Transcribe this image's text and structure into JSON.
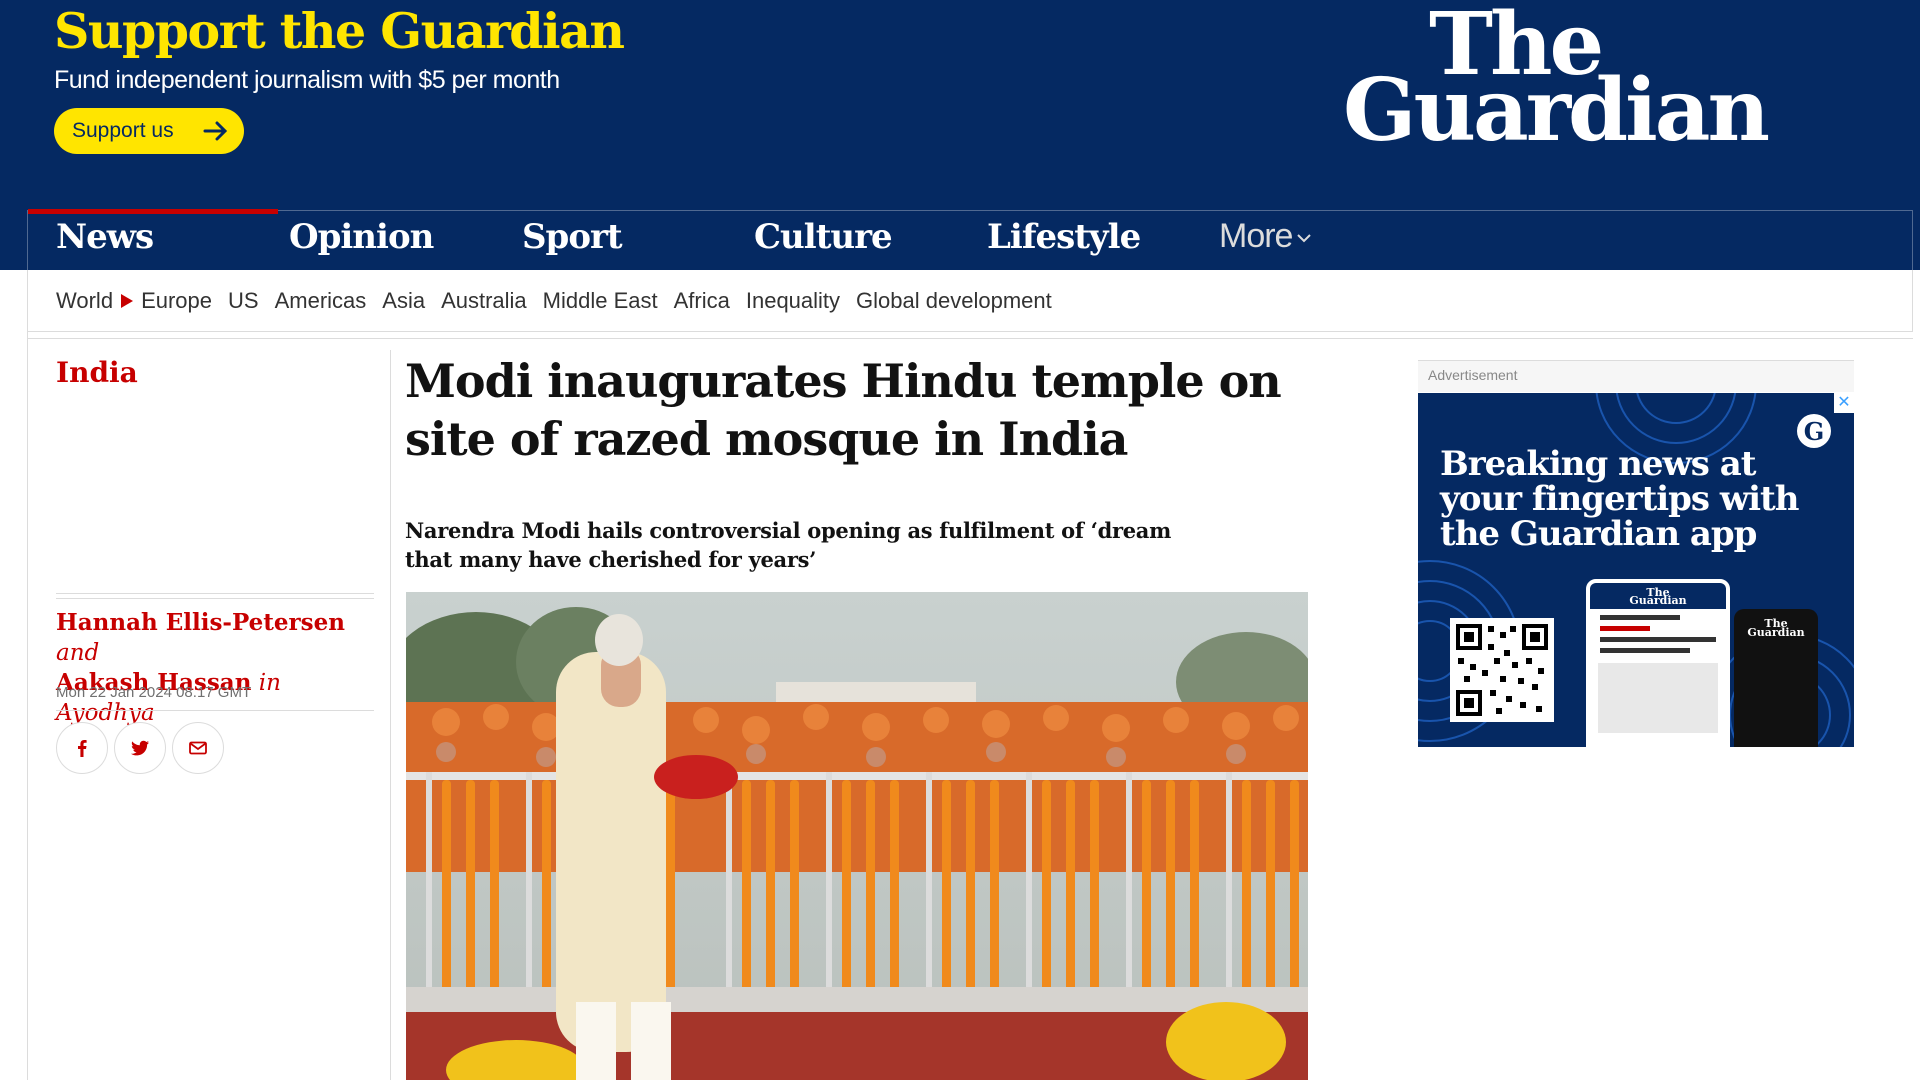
{
  "header": {
    "support_title": "Support the Guardian",
    "support_subtitle": "Fund independent journalism with $5 per month",
    "support_button": "Support us",
    "logo_line1": "The",
    "logo_line2": "Guardian"
  },
  "nav": {
    "items": [
      {
        "label": "News",
        "active": true
      },
      {
        "label": "Opinion"
      },
      {
        "label": "Sport"
      },
      {
        "label": "Culture"
      },
      {
        "label": "Lifestyle"
      }
    ],
    "more_label": "More"
  },
  "subnav": {
    "items": [
      "World",
      "Europe",
      "US",
      "Americas",
      "Asia",
      "Australia",
      "Middle East",
      "Africa",
      "Inequality",
      "Global development"
    ]
  },
  "article": {
    "section": "India",
    "headline": "Modi inaugurates Hindu temple on site of razed mosque in India",
    "standfirst": "Narendra Modi hails controversial opening as fulfilment of ‘dream that many have cherished for years’",
    "author1": "Hannah Ellis-Petersen",
    "byline_and": "and",
    "author2": "Aakash Hassan",
    "location": "in Ayodhya",
    "dateline": "Mon 22 Jan 2024 08.17 GMT"
  },
  "share": {
    "facebook_icon": "facebook-icon",
    "twitter_icon": "twitter-icon",
    "email_icon": "email-icon"
  },
  "advert": {
    "label": "Advertisement",
    "headline": "Breaking news at your fingertips with the Guardian app",
    "close_label": "✕",
    "phone_logo_line1": "The",
    "phone_logo_line2": "Guardian"
  },
  "colors": {
    "brand_blue": "#052962",
    "support_yellow": "#ffe500",
    "news_red": "#c70000"
  }
}
